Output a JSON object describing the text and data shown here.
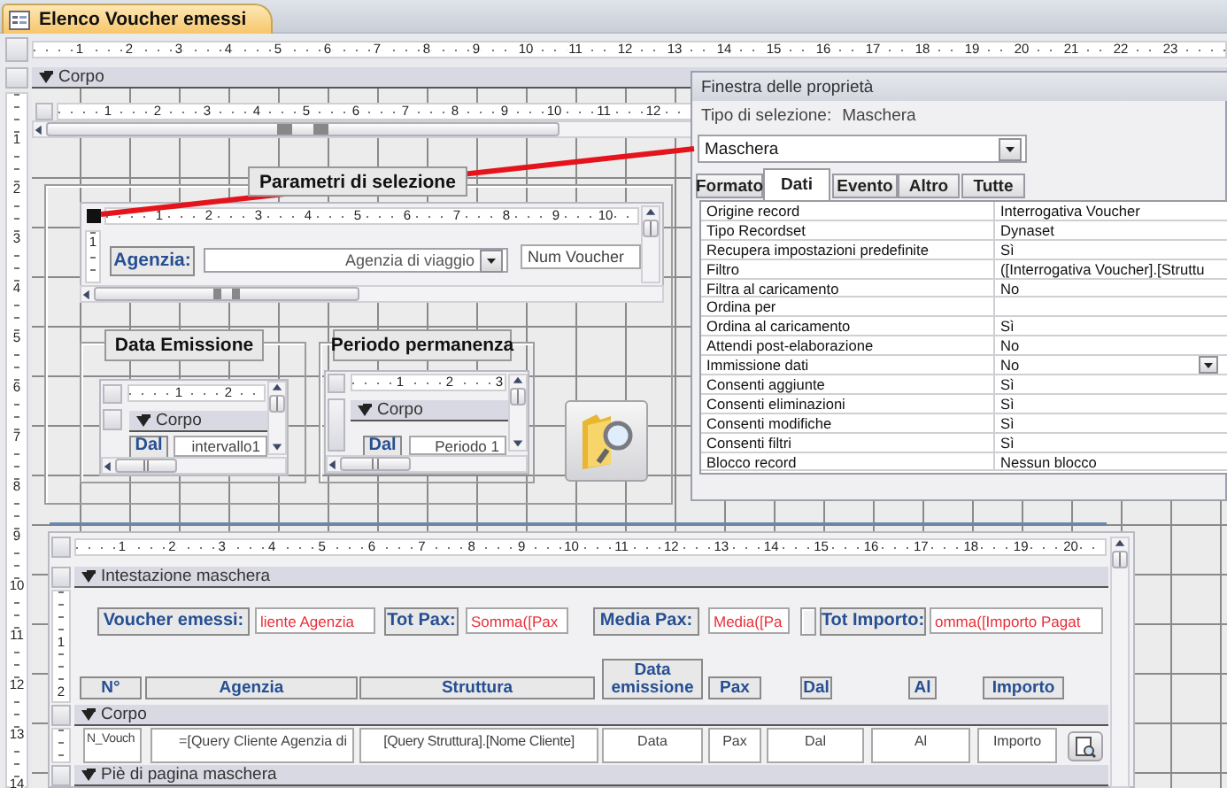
{
  "document_tab": {
    "title": "Elenco Voucher emessi",
    "selected": true
  },
  "horizontal_ruler": [
    "1",
    "2",
    "3",
    "4",
    "5",
    "6",
    "7",
    "8",
    "9",
    "10",
    "11",
    "12",
    "13",
    "14",
    "15",
    "16",
    "17",
    "18",
    "19",
    "20",
    "21",
    "22",
    "23"
  ],
  "vertical_ruler": [
    "1",
    "2",
    "3",
    "4",
    "5",
    "6",
    "7",
    "8",
    "9",
    "10",
    "11",
    "12",
    "13",
    "14"
  ],
  "form": {
    "section": "Corpo",
    "header_subform": {
      "ruler": [
        "1",
        "2",
        "3",
        "4",
        "5",
        "6",
        "7",
        "8",
        "9",
        "10",
        "11",
        "12"
      ]
    },
    "selection_group": {
      "title": "Parametri di selezione",
      "agency_subform": {
        "ruler": [
          "1",
          "2",
          "3",
          "4",
          "5",
          "6",
          "7",
          "8",
          "9",
          "10"
        ],
        "side_ruler": [
          "1"
        ],
        "label": "Agenzia:",
        "combo_value": "Agenzia di viaggio",
        "field_value": "Num Voucher"
      },
      "date_group": {
        "title": "Data Emissione",
        "ruler": [
          "1",
          "2"
        ],
        "section": "Corpo",
        "label": "Dal",
        "field_value": "intervallo1"
      },
      "period_group": {
        "title": "Periodo permanenza",
        "ruler": [
          "1",
          "2",
          "3"
        ],
        "section": "Corpo",
        "label": "Dal",
        "field_value": "Periodo 1"
      }
    },
    "list_subform": {
      "ruler": [
        "1",
        "2",
        "3",
        "4",
        "5",
        "6",
        "7",
        "8",
        "9",
        "10",
        "11",
        "12",
        "13",
        "14",
        "15",
        "16",
        "17",
        "18",
        "19",
        "20"
      ],
      "side_ruler": [
        "1",
        "2"
      ],
      "header_section": "Intestazione maschera",
      "totals": [
        {
          "label": "Voucher emessi:",
          "value": "liente Agenzia"
        },
        {
          "label": "Tot Pax:",
          "value": "Somma([Pax"
        },
        {
          "label": "Media Pax:",
          "value": "Media([Pa"
        },
        {
          "label": "Tot Importo:",
          "value": "omma([Importo Pagat"
        }
      ],
      "columns": [
        "N°",
        "Agenzia",
        "Struttura",
        "Data emissione",
        "Pax",
        "Dal",
        "Al",
        "Importo"
      ],
      "body_section": "Corpo",
      "fields": [
        "N_Vouch",
        "=[Query Cliente Agenzia di",
        "[Query  Struttura].[Nome Cliente]",
        "Data",
        "Pax",
        "Dal",
        "Al",
        "Importo"
      ],
      "footer_section": "Piè di pagina maschera"
    }
  },
  "property_sheet": {
    "title": "Finestra delle proprietà",
    "selection_label": "Tipo di selezione:",
    "selection_value": "Maschera",
    "object": "Maschera",
    "tabs": [
      {
        "label": "Formato",
        "selected": false
      },
      {
        "label": "Dati",
        "selected": true
      },
      {
        "label": "Evento",
        "selected": false
      },
      {
        "label": "Altro",
        "selected": false
      },
      {
        "label": "Tutte",
        "selected": false
      }
    ],
    "properties": [
      {
        "name": "Origine record",
        "value": "Interrogativa Voucher",
        "kind": "text"
      },
      {
        "name": "Tipo Recordset",
        "value": "Dynaset",
        "kind": "text"
      },
      {
        "name": "Recupera impostazioni predefinite",
        "value": "Sì",
        "kind": "text"
      },
      {
        "name": "Filtro",
        "value": "([Interrogativa Voucher].[Struttu",
        "kind": "text"
      },
      {
        "name": "Filtra al caricamento",
        "value": "No",
        "kind": "text"
      },
      {
        "name": "Ordina per",
        "kind": "text"
      },
      {
        "name": "Ordina al caricamento",
        "value": "Sì",
        "kind": "text"
      },
      {
        "name": "Attendi post-elaborazione",
        "value": "No",
        "kind": "text"
      },
      {
        "name": "Immissione dati",
        "value": "No",
        "kind": "combo"
      },
      {
        "name": "Consenti aggiunte",
        "value": "Sì",
        "kind": "text"
      },
      {
        "name": "Consenti eliminazioni",
        "value": "Sì",
        "kind": "text"
      },
      {
        "name": "Consenti modifiche",
        "value": "Sì",
        "kind": "text"
      },
      {
        "name": "Consenti filtri",
        "value": "Sì",
        "kind": "text"
      },
      {
        "name": "Blocco record",
        "value": "Nessun blocco",
        "kind": "text"
      }
    ]
  }
}
